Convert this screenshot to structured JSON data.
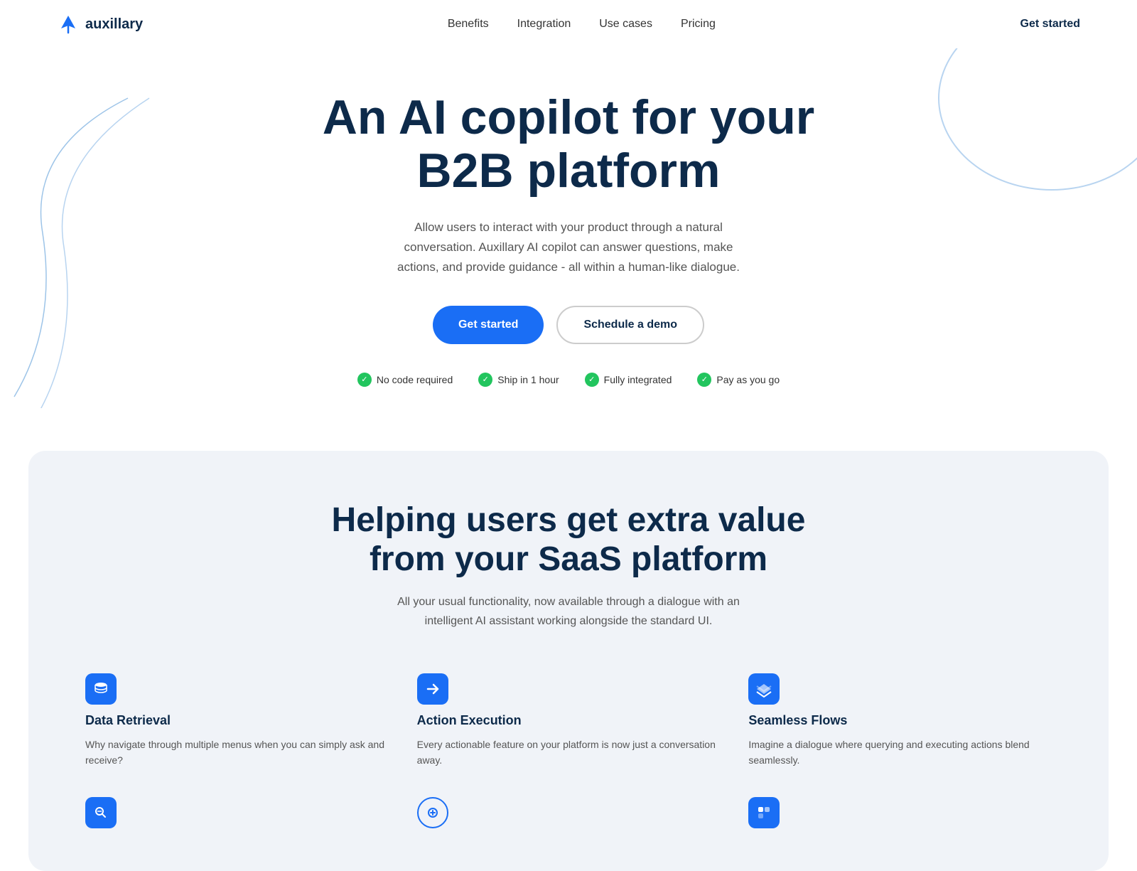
{
  "nav": {
    "logo_text": "auxillary",
    "links": [
      "Benefits",
      "Integration",
      "Use cases",
      "Pricing"
    ],
    "cta": "Get started"
  },
  "hero": {
    "heading_line1": "An AI copilot for your",
    "heading_line2": "B2B platform",
    "subtext": "Allow users to interact with your product through a natural conversation. Auxillary AI copilot can answer questions, make actions, and provide guidance - all within a human-like dialogue.",
    "btn_primary": "Get started",
    "btn_outline": "Schedule a demo",
    "badges": [
      "No code required",
      "Ship in 1 hour",
      "Fully integrated",
      "Pay as you go"
    ]
  },
  "section2": {
    "heading_line1": "Helping users get extra value",
    "heading_line2": "from your SaaS platform",
    "subtext": "All your usual functionality, now available through a dialogue with an intelligent AI assistant working alongside the standard UI.",
    "features": [
      {
        "title": "Data Retrieval",
        "description": "Why navigate through multiple menus when you can simply ask and receive?"
      },
      {
        "title": "Action Execution",
        "description": "Every actionable feature on your platform is now just a conversation away."
      },
      {
        "title": "Seamless Flows",
        "description": "Imagine a dialogue where querying and executing actions blend seamlessly."
      }
    ]
  }
}
